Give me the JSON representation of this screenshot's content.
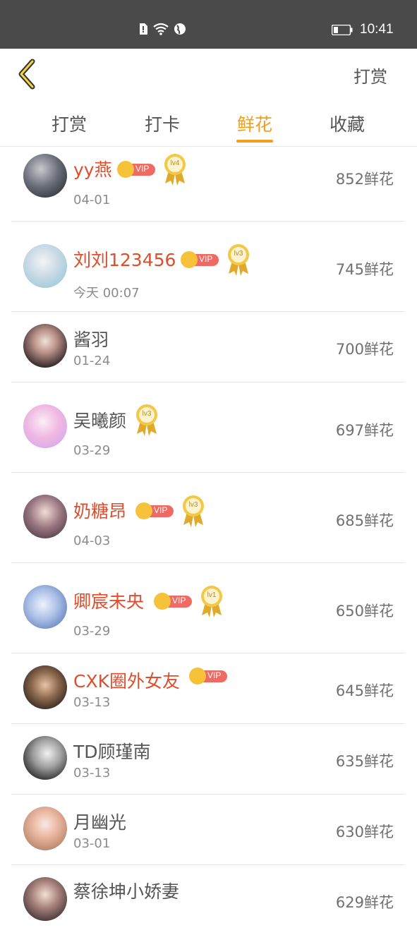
{
  "status_bar": {
    "time": "10:41"
  },
  "nav": {
    "action_label": "打赏"
  },
  "tabs": [
    {
      "label": "打赏",
      "active": false
    },
    {
      "label": "打卡",
      "active": false
    },
    {
      "label": "鲜花",
      "active": true
    },
    {
      "label": "收藏",
      "active": false
    }
  ],
  "colors": {
    "accent": "#f2a01c",
    "vip_name": "#e04d2c",
    "status_bar": "#4a4a4a"
  },
  "rows": [
    {
      "name": "yy燕",
      "date": "04-01",
      "value": "852鲜花",
      "vip": true,
      "level": "lv4"
    },
    {
      "name": "刘刘123456",
      "date": "今天 00:07",
      "value": "745鲜花",
      "vip": true,
      "level": "lv3"
    },
    {
      "name": "酱羽",
      "date": "01-24",
      "value": "700鲜花",
      "vip": false,
      "level": ""
    },
    {
      "name": "吴曦颜",
      "date": "03-29",
      "value": "697鲜花",
      "vip": false,
      "level": "lv3"
    },
    {
      "name": "奶糖昂",
      "date": "04-03",
      "value": "685鲜花",
      "vip": true,
      "level": "lv3"
    },
    {
      "name": "卿宸未央",
      "date": "03-29",
      "value": "650鲜花",
      "vip": true,
      "level": "lv1"
    },
    {
      "name": "CXK圈外女友",
      "date": "03-13",
      "value": "645鲜花",
      "vip": true,
      "level": ""
    },
    {
      "name": "TD顾瑾南",
      "date": "03-13",
      "value": "635鲜花",
      "vip": false,
      "level": ""
    },
    {
      "name": "月幽光",
      "date": "03-01",
      "value": "630鲜花",
      "vip": false,
      "level": ""
    },
    {
      "name": "蔡徐坤小娇妻",
      "date": "",
      "value": "629鲜花",
      "vip": false,
      "level": ""
    }
  ],
  "vip_label": "VIP"
}
